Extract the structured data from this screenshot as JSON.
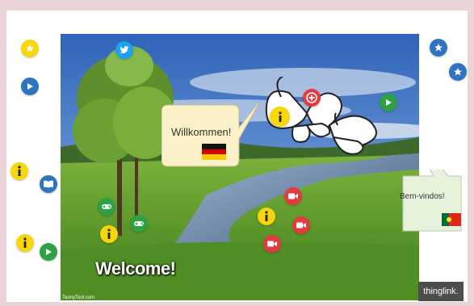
{
  "speech_bubbles": {
    "german": {
      "text": "Willkommen!",
      "flag": "germany-flag"
    },
    "portuguese": {
      "text": "Bem-vindos!",
      "flag": "portugal-flag"
    }
  },
  "welcome_text": "Welcome!",
  "credit": "ToonyTool.com",
  "brand": "thinglink."
}
